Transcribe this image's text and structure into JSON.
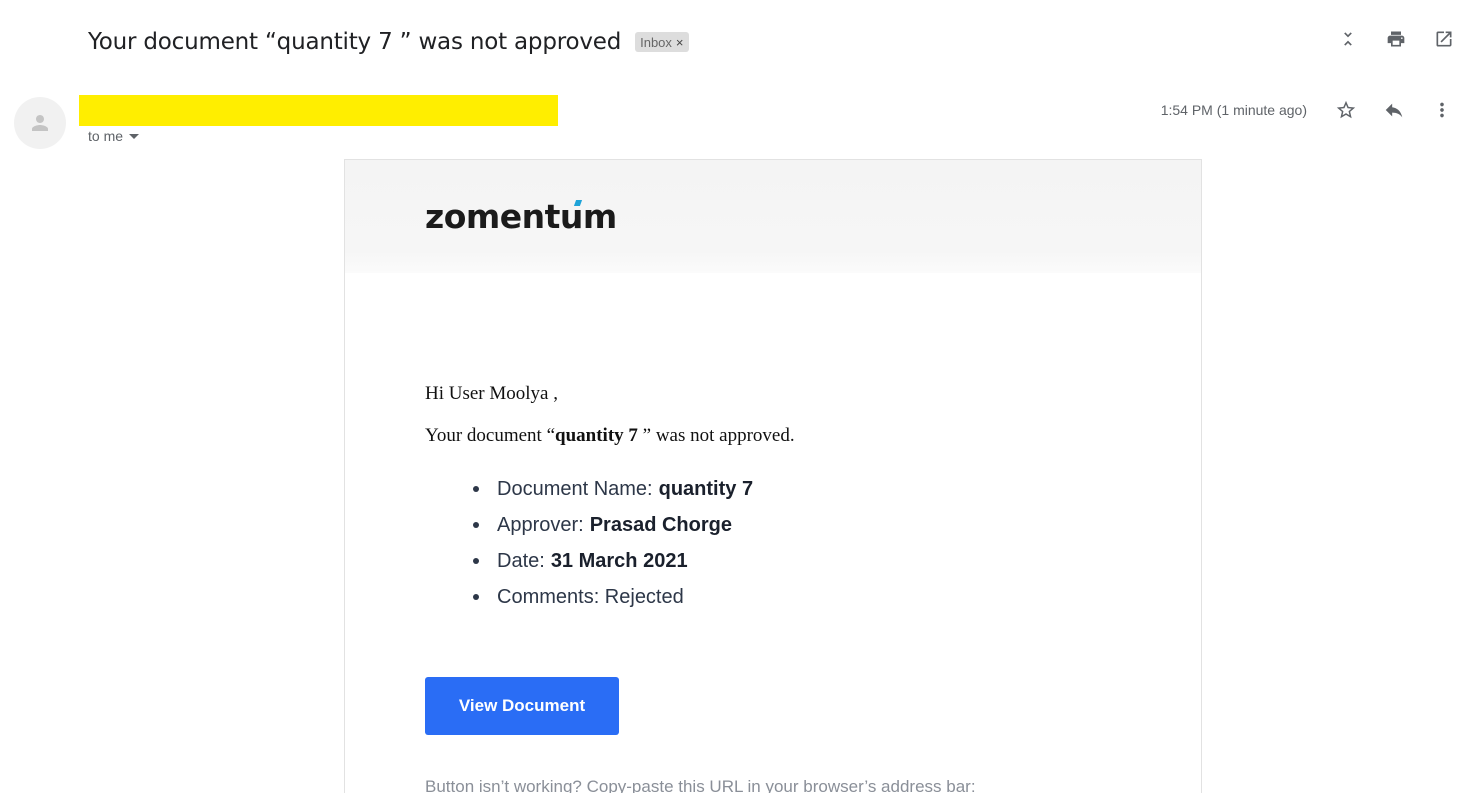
{
  "subject": {
    "title": "Your document “quantity 7 ” was not approved",
    "label_chip": "Inbox",
    "chip_close": "×"
  },
  "toolbar": {
    "icons": [
      "collapse-icon",
      "print-icon",
      "open-in-new-window-icon"
    ]
  },
  "sender": {
    "recipient_label": "to me",
    "timestamp": "1:54 PM (1 minute ago)",
    "icons": [
      "star-icon",
      "reply-icon",
      "more-vert-icon"
    ],
    "redaction_color": "#ffee00"
  },
  "email": {
    "brand": "zomentum",
    "greeting": "Hi User Moolya ,",
    "intro_prefix": "Your document “",
    "intro_doc": "quantity 7 ",
    "intro_suffix": "” was not approved.",
    "details": [
      {
        "label": "Document Name:",
        "value": "quantity 7"
      },
      {
        "label": "Approver:",
        "value": "Prasad Chorge"
      },
      {
        "label": "Date:",
        "value": "31 March 2021"
      },
      {
        "label": "Comments: Rejected",
        "value": ""
      }
    ],
    "button_label": "View Document",
    "fallback_text": "Button isn’t working? Copy-paste this URL in your browser’s address bar:",
    "button_color": "#2a6df5"
  }
}
